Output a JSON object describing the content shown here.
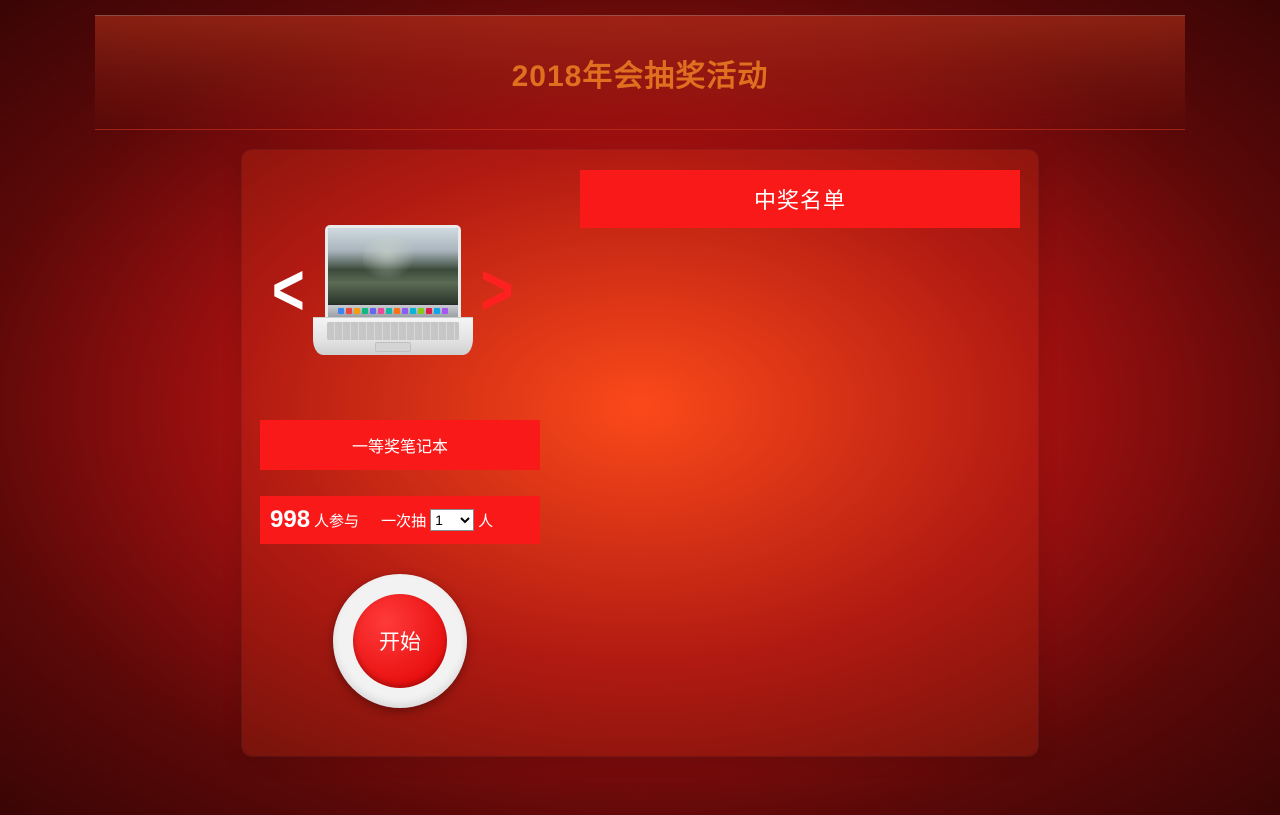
{
  "header": {
    "title": "2018年会抽奖活动"
  },
  "prize": {
    "label": "一等奖笔记本",
    "prev": "<",
    "next": ">"
  },
  "participants": {
    "count": "998",
    "count_suffix": "人参与",
    "draw_prefix": "一次抽",
    "draw_suffix": "人",
    "selected": "1"
  },
  "start": {
    "label": "开始"
  },
  "winners": {
    "title": "中奖名单"
  },
  "dock_colors": [
    "#3b82f6",
    "#ef4444",
    "#f59e0b",
    "#10b981",
    "#6366f1",
    "#ec4899",
    "#14b8a6",
    "#f97316",
    "#8b5cf6",
    "#06b6d4",
    "#84cc16",
    "#e11d48",
    "#0ea5e9",
    "#a855f7"
  ]
}
